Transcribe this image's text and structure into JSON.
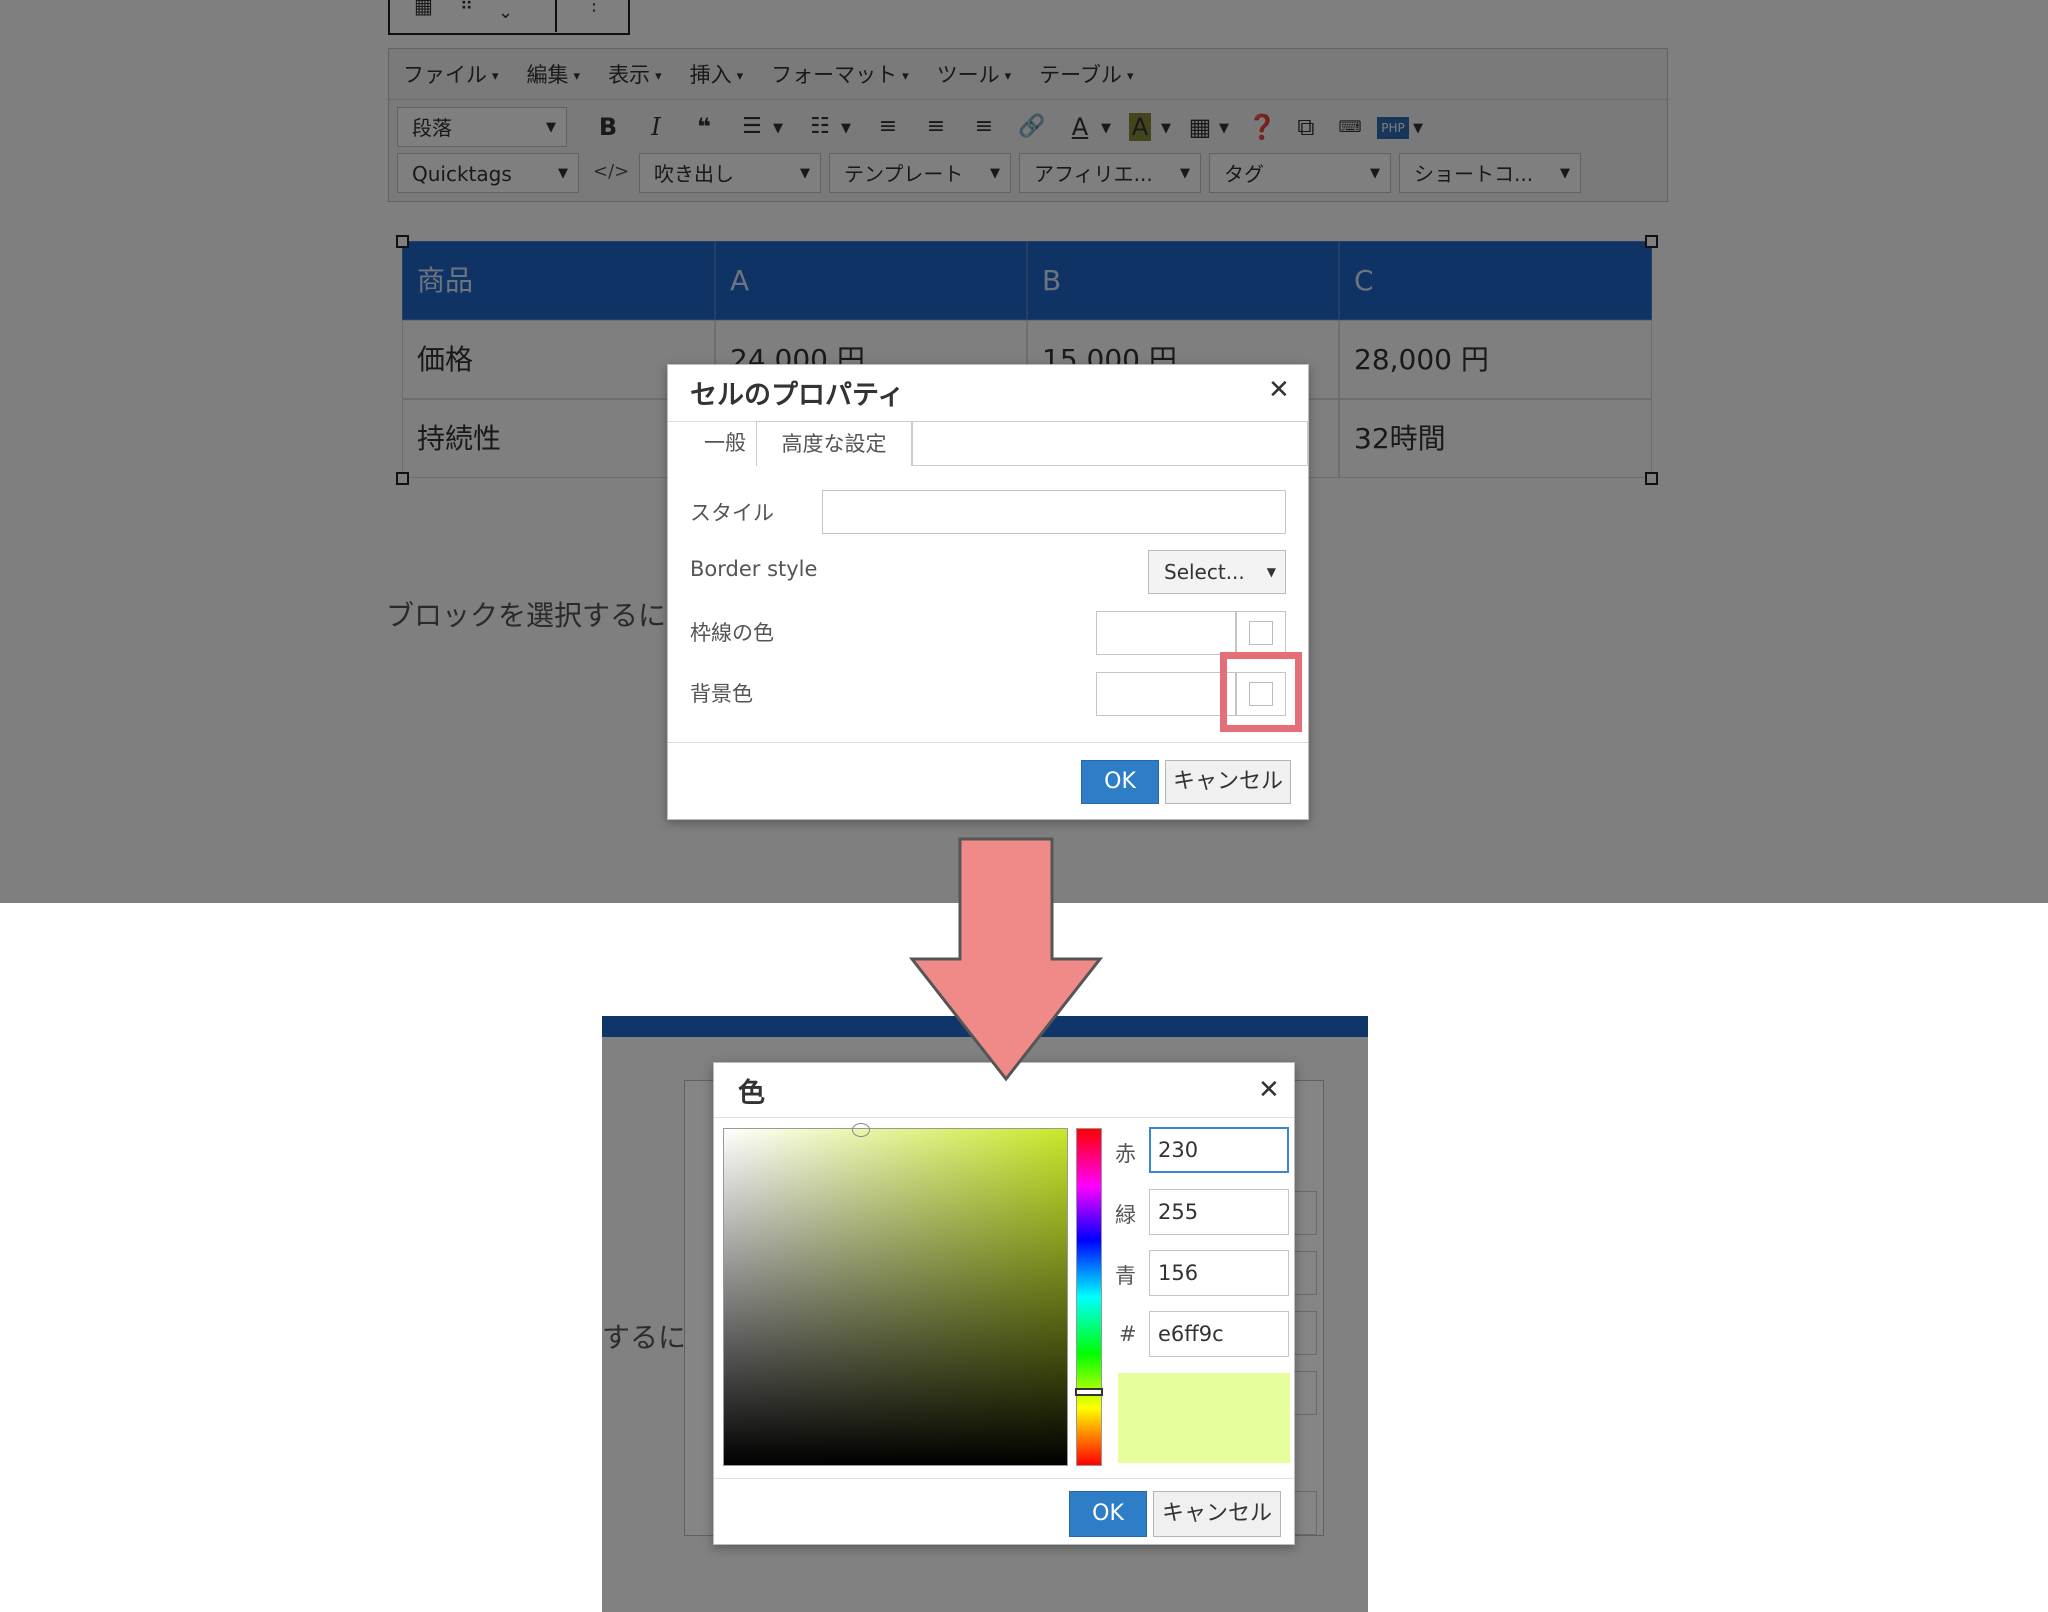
{
  "toolbar": {
    "menus": [
      "ファイル",
      "編集",
      "表示",
      "挿入",
      "フォーマット",
      "ツール",
      "テーブル"
    ],
    "paragraph_select": "段落",
    "quicktags_select": "Quicktags",
    "fukidashi_select": "吹き出し",
    "template_select": "テンプレート",
    "affiliate_select": "アフィリエ...",
    "tag_select": "タグ",
    "shortcode_select": "ショートコ...",
    "php_label": "PHP",
    "code_label": "</>"
  },
  "table": {
    "headers": [
      "商品",
      "A",
      "B",
      "C"
    ],
    "rows": [
      [
        "価格",
        "24,000 円",
        "15,000 円",
        "28,000 円"
      ],
      [
        "持続性",
        "",
        "",
        "32時間"
      ]
    ]
  },
  "paragraph_hint": "ブロックを選択するに",
  "cell_dialog": {
    "title": "セルのプロパティ",
    "tabs": [
      "一般",
      "高度な設定"
    ],
    "style_label": "スタイル",
    "border_style_label": "Border style",
    "border_style_value": "Select...",
    "border_color_label": "枠線の色",
    "bg_color_label": "背景色",
    "ok": "OK",
    "cancel": "キャンセル"
  },
  "color_dialog": {
    "title": "色",
    "red_label": "赤",
    "green_label": "緑",
    "blue_label": "青",
    "hex_label": "#",
    "red": "230",
    "green": "255",
    "blue": "156",
    "hex": "e6ff9c",
    "preview_color": "#e6ff9c",
    "ok": "OK",
    "cancel": "キャンセル"
  },
  "bottom_hint": "するに",
  "colors": {
    "arrow": "#f08a88",
    "highlight": "#e66e78",
    "table_header": "#1f66c8",
    "ok_button": "#2d7ec6"
  }
}
